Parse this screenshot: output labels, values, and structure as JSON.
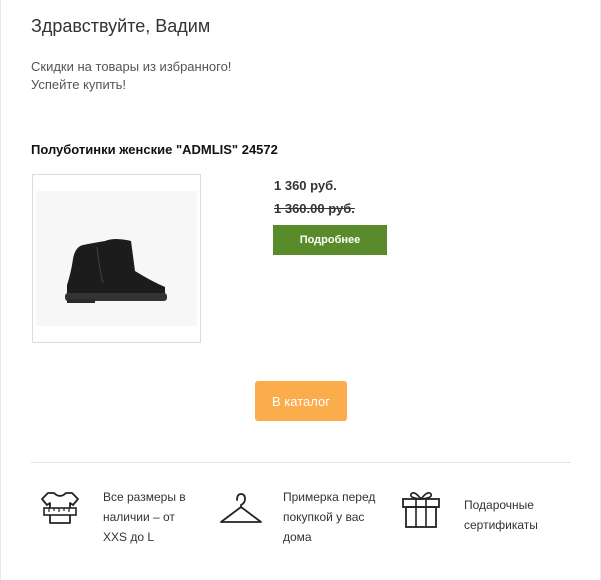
{
  "greeting": "Здравствуйте, Вадим",
  "promo": {
    "line1": "Скидки на товары из избранного!",
    "line2": "Успейте купить!"
  },
  "product": {
    "title": "Полуботинки женские \"ADMLIS\" 24572",
    "price": "1 360 руб.",
    "old_price": "1 360.00 руб.",
    "details_label": "Подробнее",
    "image_icon": "ankle-boot-image"
  },
  "catalog_label": "В каталог",
  "features": [
    {
      "icon": "sizes-icon",
      "lines": [
        "Все размеры в",
        "наличии – от",
        "XXS до L"
      ]
    },
    {
      "icon": "hanger-icon",
      "lines": [
        "Примерка перед",
        "покупкой у вас",
        "дома"
      ]
    },
    {
      "icon": "gift-icon",
      "lines": [
        "Подарочные",
        "сертификаты"
      ]
    }
  ],
  "colors": {
    "details_button": "#5a8b2a",
    "catalog_button": "#fbac4b"
  }
}
